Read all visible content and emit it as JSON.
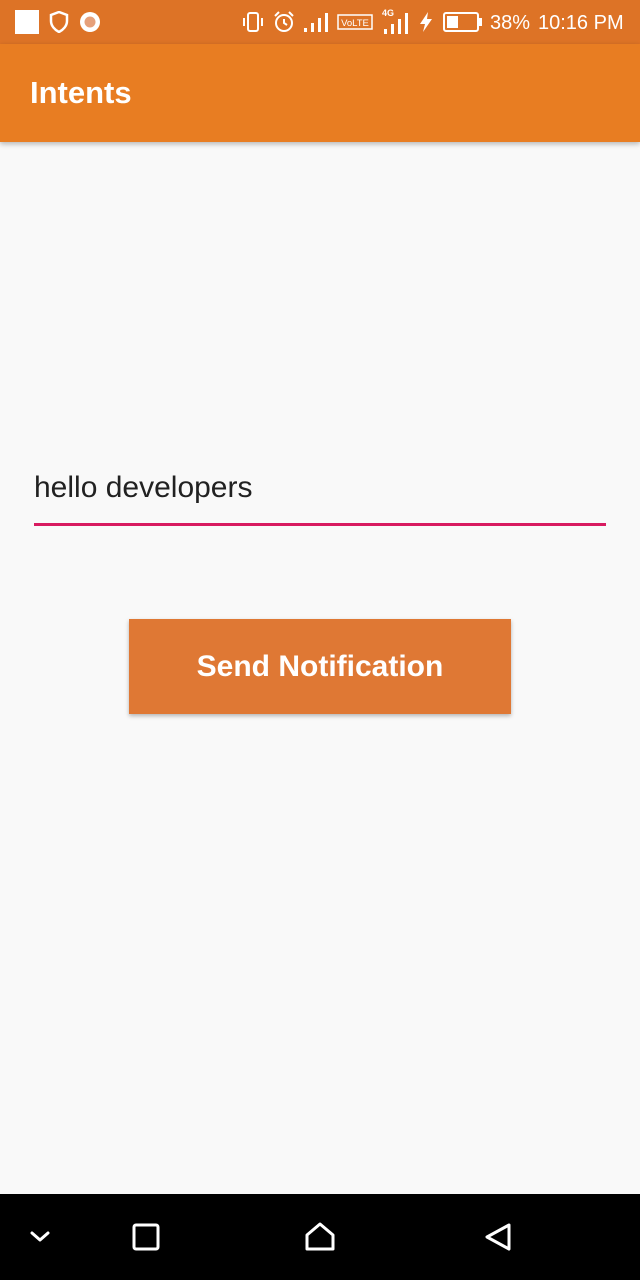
{
  "status_bar": {
    "battery_percent": "38%",
    "time": "10:16 PM",
    "network_label": "4G",
    "volte_label": "VoLTE",
    "icons": [
      "notification-square-icon",
      "shield-icon",
      "record-icon",
      "vibrate-icon",
      "alarm-icon",
      "signal-icon",
      "volte-icon",
      "signal-4g-icon",
      "charging-icon",
      "battery-icon"
    ],
    "background_color": "#dd7326"
  },
  "app_bar": {
    "title": "Intents",
    "background_color": "#e87d22"
  },
  "message_field": {
    "value": "hello developers",
    "underline_color": "#d81b60"
  },
  "send_button": {
    "label": "Send Notification",
    "background_color": "#df7834"
  },
  "nav_bar": {
    "buttons": [
      "collapse-chevron-icon",
      "recents-square-icon",
      "home-icon",
      "back-triangle-icon"
    ]
  }
}
